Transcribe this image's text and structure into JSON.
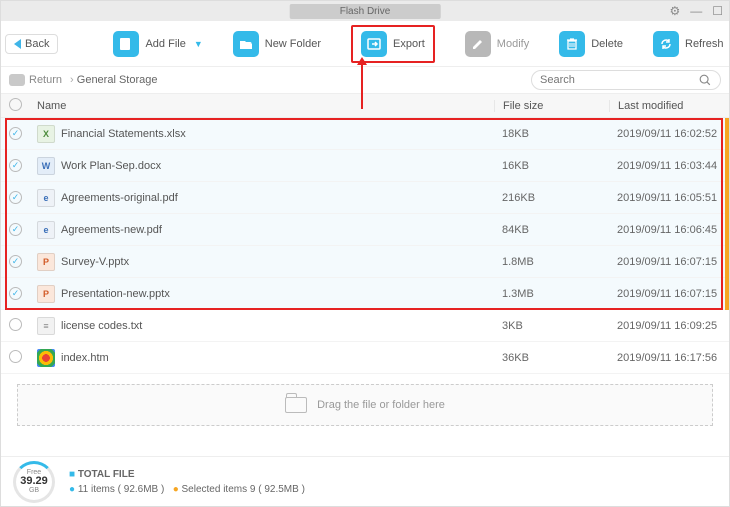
{
  "window": {
    "title": "Flash Drive"
  },
  "toolbar": {
    "back": "Back",
    "addFile": "Add File",
    "newFolder": "New Folder",
    "export": "Export",
    "modify": "Modify",
    "delete": "Delete",
    "refresh": "Refresh"
  },
  "breadcrumb": {
    "return": "Return",
    "path": "General Storage"
  },
  "search": {
    "placeholder": "Search"
  },
  "columns": {
    "name": "Name",
    "size": "File size",
    "modified": "Last modified"
  },
  "files": [
    {
      "name": "Financial Statements.xlsx",
      "size": "18KB",
      "modified": "2019/09/11 16:02:52",
      "icon": "xlsx",
      "selected": true
    },
    {
      "name": "Work Plan-Sep.docx",
      "size": "16KB",
      "modified": "2019/09/11 16:03:44",
      "icon": "docx",
      "selected": true
    },
    {
      "name": "Agreements-original.pdf",
      "size": "216KB",
      "modified": "2019/09/11 16:05:51",
      "icon": "pdf",
      "selected": true
    },
    {
      "name": "Agreements-new.pdf",
      "size": "84KB",
      "modified": "2019/09/11 16:06:45",
      "icon": "pdf",
      "selected": true
    },
    {
      "name": "Survey-V.pptx",
      "size": "1.8MB",
      "modified": "2019/09/11 16:07:15",
      "icon": "pptx",
      "selected": true
    },
    {
      "name": "Presentation-new.pptx",
      "size": "1.3MB",
      "modified": "2019/09/11 16:07:15",
      "icon": "pptx",
      "selected": true
    },
    {
      "name": "license codes.txt",
      "size": "3KB",
      "modified": "2019/09/11 16:09:25",
      "icon": "txt",
      "selected": false
    },
    {
      "name": "index.htm",
      "size": "36KB",
      "modified": "2019/09/11 16:17:56",
      "icon": "htm",
      "selected": false
    }
  ],
  "dropzone": {
    "text": "Drag the file or folder here"
  },
  "footer": {
    "freeLabel": "Free",
    "freeValue": "39.29",
    "freeUnit": "GB",
    "totalLabel": "TOTAL FILE",
    "totalStats": "11 items ( 92.6MB )",
    "selectedStats": "Selected items 9 ( 92.5MB )"
  }
}
